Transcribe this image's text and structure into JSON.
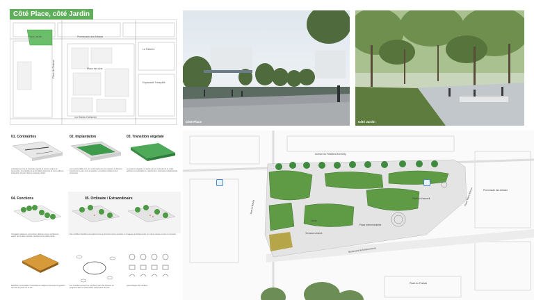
{
  "title": "Côté Place, côté Jardin",
  "sitemap": {
    "labels": {
      "place_jardin": "Place Jardin",
      "promenade": "Promenade des Artistes",
      "place_arts": "Place des Arts",
      "parterre": "Le Parterre",
      "esplanade": "Esplanade Tranquille",
      "place_festival": "Place du Festival",
      "sainte_catherine": "rue Sainte-Catherine"
    }
  },
  "photos": {
    "place_caption": "Côté Place",
    "jardin_caption": "Côté Jardin"
  },
  "steps": [
    {
      "title": "01. Contraintes",
      "text": "L'abaissement de la chaussée appuie la lecture unique de l'ensemble. Une fluidité de la circulation piétonne et une meilleure intégration du parc dans le contexte urbain."
    },
    {
      "title": "02. Implantation",
      "text": "La nouvelle dalle crée une continuité entre les espaces et favorise l'ouverture du parc vers le quartier. Les arbres existants sont conservés."
    },
    {
      "title": "03. Transition végétale",
      "text": "Le gradient végétal est réalisé par la continuité de la strate arborée et la plantation en pleine terre, favorisant la biodiversité."
    },
    {
      "title": "04. Fonctions",
      "text": "Circulation piétonne, rencontres, détente et jeux s'articulent autour de la place centrale minérale et du jardin planté."
    },
    {
      "title": "05. Ordinaire / Extraordinaire",
      "text": "Des mobiliers flexibles permettent la tenue d'événements ponctuels et d'usages quotidiens dans un même espace ouvert et convivial."
    }
  ],
  "extra_texts": {
    "modules": "Assemblages de mobiliers",
    "bottom_left": "Matériaux perméables et plantations indigènes favorisent la gestion de l'eau de pluie sur le site.",
    "bottom_mid": "Les modules peuvent se combiner selon les besoins de programmation et d'animation saisonnière du parc."
  },
  "plan": {
    "labels": {
      "avenue": "Avenue du Président-Kennedy",
      "bleury": "Rue de Bleury",
      "boulevard": "Boulevard de Maisonneuve",
      "marie": "Place Marie-Mance",
      "promenade": "Promenade des Artistes",
      "jardin": "Jardin",
      "place": "Place événementielle",
      "terrasse": "Terrasse urbaine",
      "pavillon": "Pavillon d'accueil",
      "fontaine": "Place du Festival"
    }
  }
}
